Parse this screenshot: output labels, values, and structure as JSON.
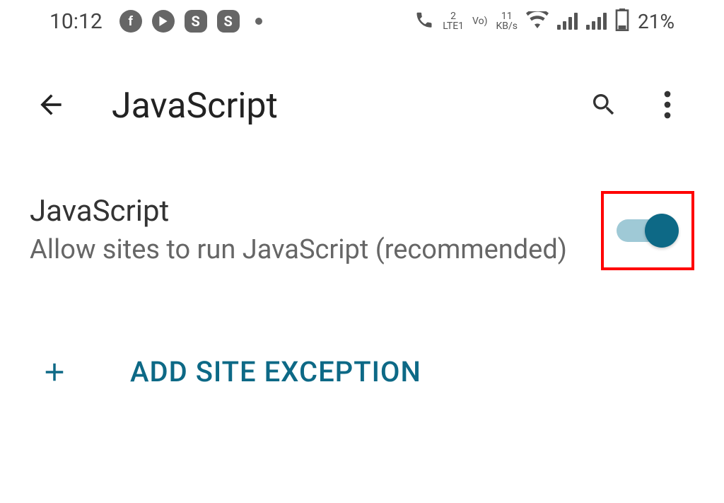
{
  "statusBar": {
    "time": "10:12",
    "netLabel1Top": "2",
    "netLabel1Bottom": "LTE1",
    "voLabel": "Vo)",
    "dataRateTop": "11",
    "dataRateBottom": "KB/s",
    "batteryPct": "21%"
  },
  "appBar": {
    "title": "JavaScript"
  },
  "setting": {
    "title": "JavaScript",
    "description": "Allow sites to run JavaScript (recommended)",
    "toggleOn": true
  },
  "addException": {
    "label": "ADD SITE EXCEPTION"
  },
  "colors": {
    "accent": "#0d6986",
    "highlight": "#f00"
  }
}
